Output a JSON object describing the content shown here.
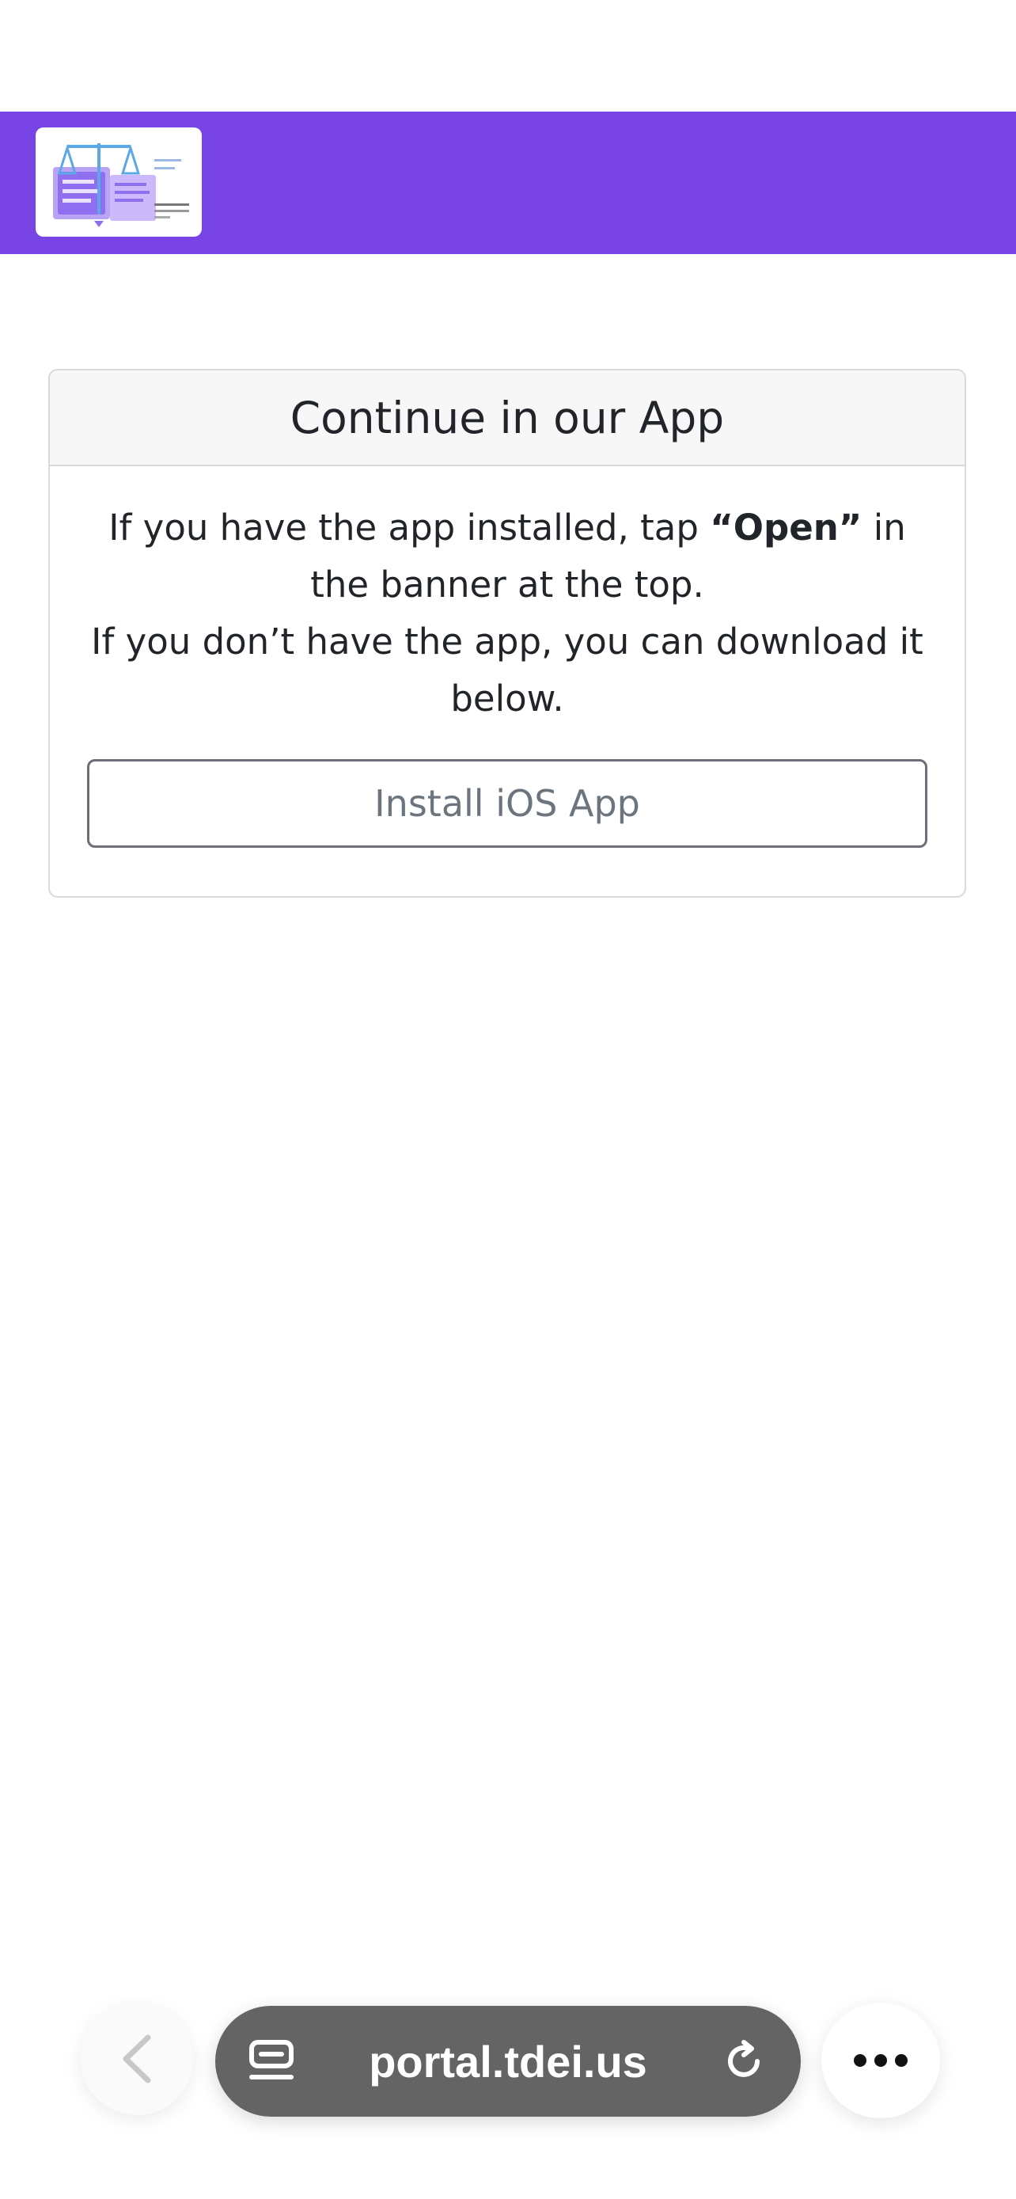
{
  "header": {
    "logo_alt": "site logo",
    "colors": {
      "bar": "#7944e6"
    }
  },
  "card": {
    "title": "Continue in our App",
    "message_part1": "If you have the app installed, tap ",
    "message_bold": "“Open”",
    "message_part2": " in the banner at the top.",
    "message_line2": "If you don’t have the app, you can download it below.",
    "install_button_label": "Install iOS App"
  },
  "browser_toolbar": {
    "url": "portal.tdei.us",
    "back_icon": "chevron-left-icon",
    "tabs_icon": "tabs-icon",
    "reload_icon": "reload-icon",
    "more_icon": "more-horizontal-icon"
  }
}
